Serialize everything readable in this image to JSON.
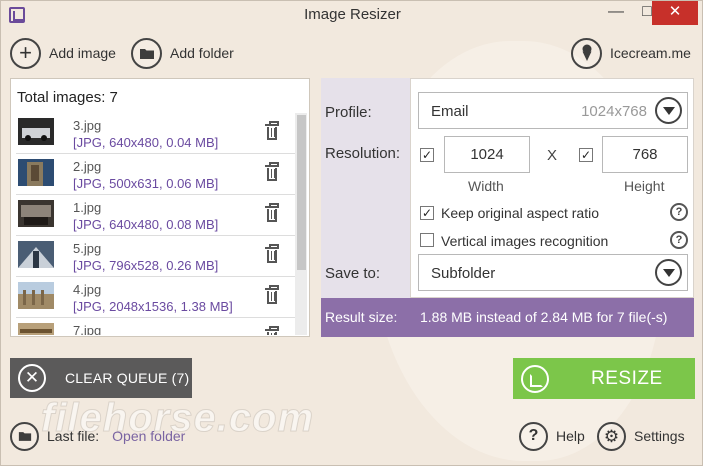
{
  "window": {
    "title": "Image Resizer",
    "minimize": "—",
    "maximize": "□",
    "close": "✕"
  },
  "toolbar": {
    "add_image": "Add image",
    "add_folder": "Add folder",
    "brand": "Icecream.me"
  },
  "queue": {
    "total_label": "Total images: 7",
    "items": [
      {
        "name": "3.jpg",
        "meta": "[JPG, 640x480, 0.04 MB]"
      },
      {
        "name": "2.jpg",
        "meta": "[JPG, 500x631, 0.06 MB]"
      },
      {
        "name": "1.jpg",
        "meta": "[JPG, 640x480, 0.08 MB]"
      },
      {
        "name": "5.jpg",
        "meta": "[JPG, 796x528, 0.26 MB]"
      },
      {
        "name": "4.jpg",
        "meta": "[JPG, 2048x1536, 1.38 MB]"
      },
      {
        "name": "7.jpg",
        "meta": ""
      }
    ]
  },
  "settings_panel": {
    "profile_label": "Profile:",
    "profile_value": "Email",
    "profile_hint": "1024x768",
    "resolution_label": "Resolution:",
    "width_value": "1024",
    "height_value": "768",
    "x_sep": "X",
    "width_label": "Width",
    "height_label": "Height",
    "keep_ratio_label": "Keep original aspect ratio",
    "keep_ratio_checked": true,
    "vertical_label": "Vertical images recognition",
    "vertical_checked": false,
    "save_to_label": "Save to:",
    "save_to_value": "Subfolder",
    "check_mark": "✓",
    "help_mark": "?"
  },
  "result": {
    "label": "Result size:",
    "text": "1.88 MB instead of 2.84 MB for 7 file(-s)"
  },
  "buttons": {
    "clear": "CLEAR QUEUE (7)",
    "resize": "RESIZE",
    "clear_icon": "✕"
  },
  "footer": {
    "last_file_label": "Last file:",
    "last_file_link": "Open folder",
    "help": "Help",
    "settings": "Settings"
  },
  "watermark": "filehorse.com",
  "colors": {
    "accent_purple": "#8c6fa8",
    "resize_green": "#7cc64a",
    "clear_gray": "#5b5a5a",
    "close_red": "#c7302a"
  }
}
